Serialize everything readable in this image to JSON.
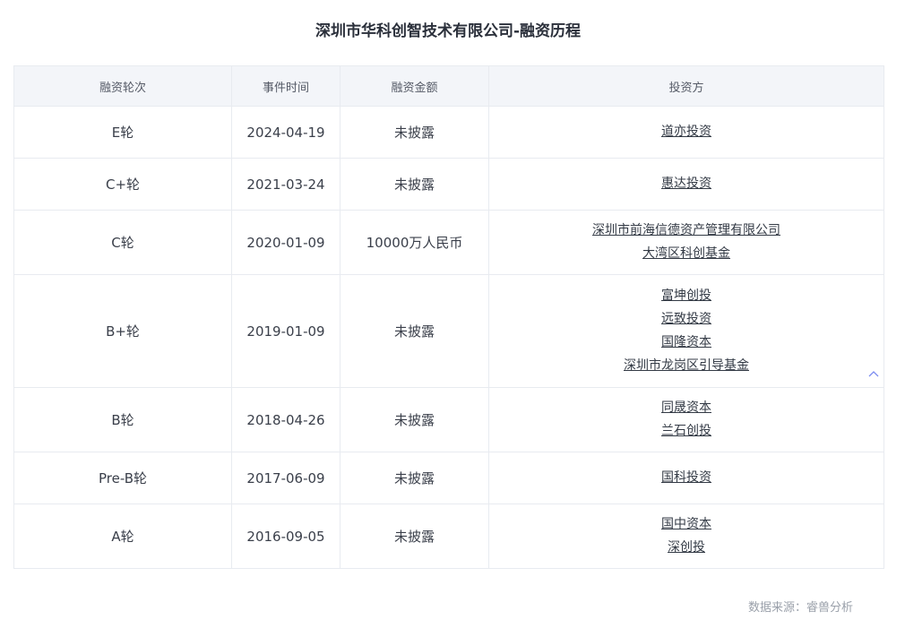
{
  "title": "深圳市华科创智技术有限公司-融资历程",
  "table": {
    "headers": [
      "融资轮次",
      "事件时间",
      "融资金额",
      "投资方"
    ],
    "rows": [
      {
        "round": "E轮",
        "date": "2024-04-19",
        "amount": "未披露",
        "investors": [
          "道亦投资"
        ]
      },
      {
        "round": "C+轮",
        "date": "2021-03-24",
        "amount": "未披露",
        "investors": [
          "惠达投资"
        ]
      },
      {
        "round": "C轮",
        "date": "2020-01-09",
        "amount": "10000万人民币",
        "investors": [
          "深圳市前海信德资产管理有限公司",
          "大湾区科创基金"
        ]
      },
      {
        "round": "B+轮",
        "date": "2019-01-09",
        "amount": "未披露",
        "investors": [
          "富坤创投",
          "远致投资",
          "国隆资本",
          "深圳市龙岗区引导基金"
        ]
      },
      {
        "round": "B轮",
        "date": "2018-04-26",
        "amount": "未披露",
        "investors": [
          "同晟资本",
          "兰石创投"
        ]
      },
      {
        "round": "Pre-B轮",
        "date": "2017-06-09",
        "amount": "未披露",
        "investors": [
          "国科投资"
        ]
      },
      {
        "round": "A轮",
        "date": "2016-09-05",
        "amount": "未披露",
        "investors": [
          "国中资本",
          "深创投"
        ]
      }
    ]
  },
  "source": "数据来源：睿兽分析",
  "icons": {
    "scroll_up": "chevron-up-icon"
  },
  "colors": {
    "header_bg": "#f3f5f9",
    "border": "#e8ebf0",
    "accent": "#7b8cf0"
  }
}
